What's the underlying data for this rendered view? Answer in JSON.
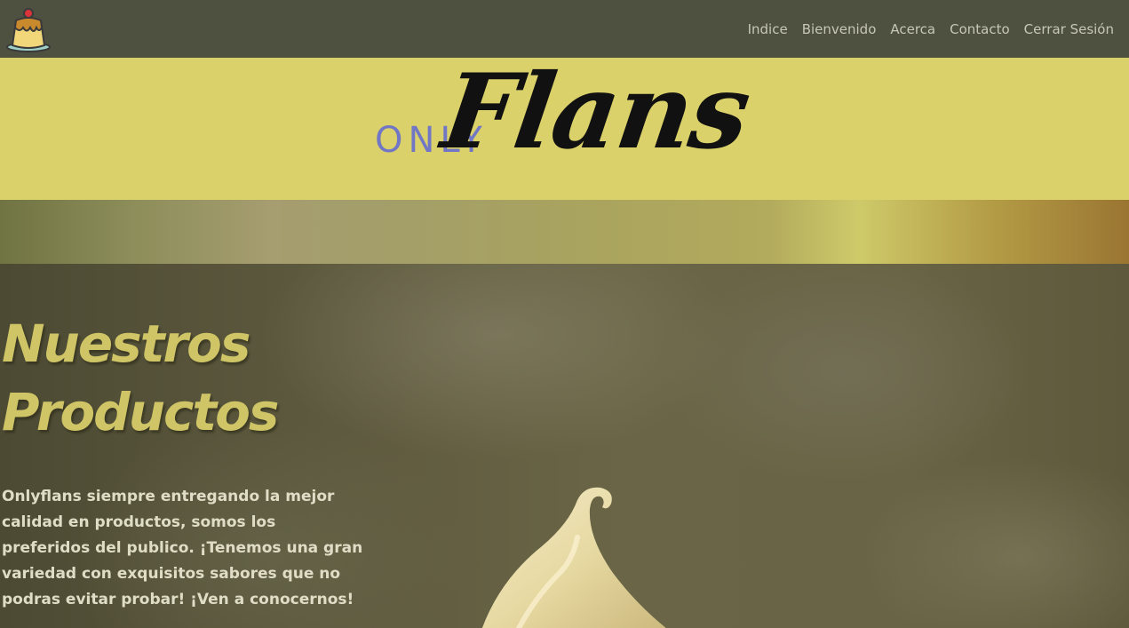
{
  "navbar": {
    "logo_icon": "flan-icon",
    "links": [
      {
        "label": "Indice"
      },
      {
        "label": "Bienvenido"
      },
      {
        "label": "Acerca"
      },
      {
        "label": "Contacto"
      },
      {
        "label": "Cerrar Sesión"
      }
    ]
  },
  "banner": {
    "brand_only": "ONLY",
    "brand_flans": "Flans",
    "only_color": "#7177c4",
    "background_color": "#dad16a"
  },
  "hero": {
    "title_line1": "Nuestros",
    "title_line2": "Productos",
    "description": "Onlyflans siempre entregando la mejor calidad en productos, somos los preferidos del publico. ¡Tenemos una gran variedad con exquisitos sabores que no podras evitar probar! ¡Ven a conocernos!",
    "title_color": "#cfc567",
    "dessert_icon": "cream-swirl-icon"
  }
}
